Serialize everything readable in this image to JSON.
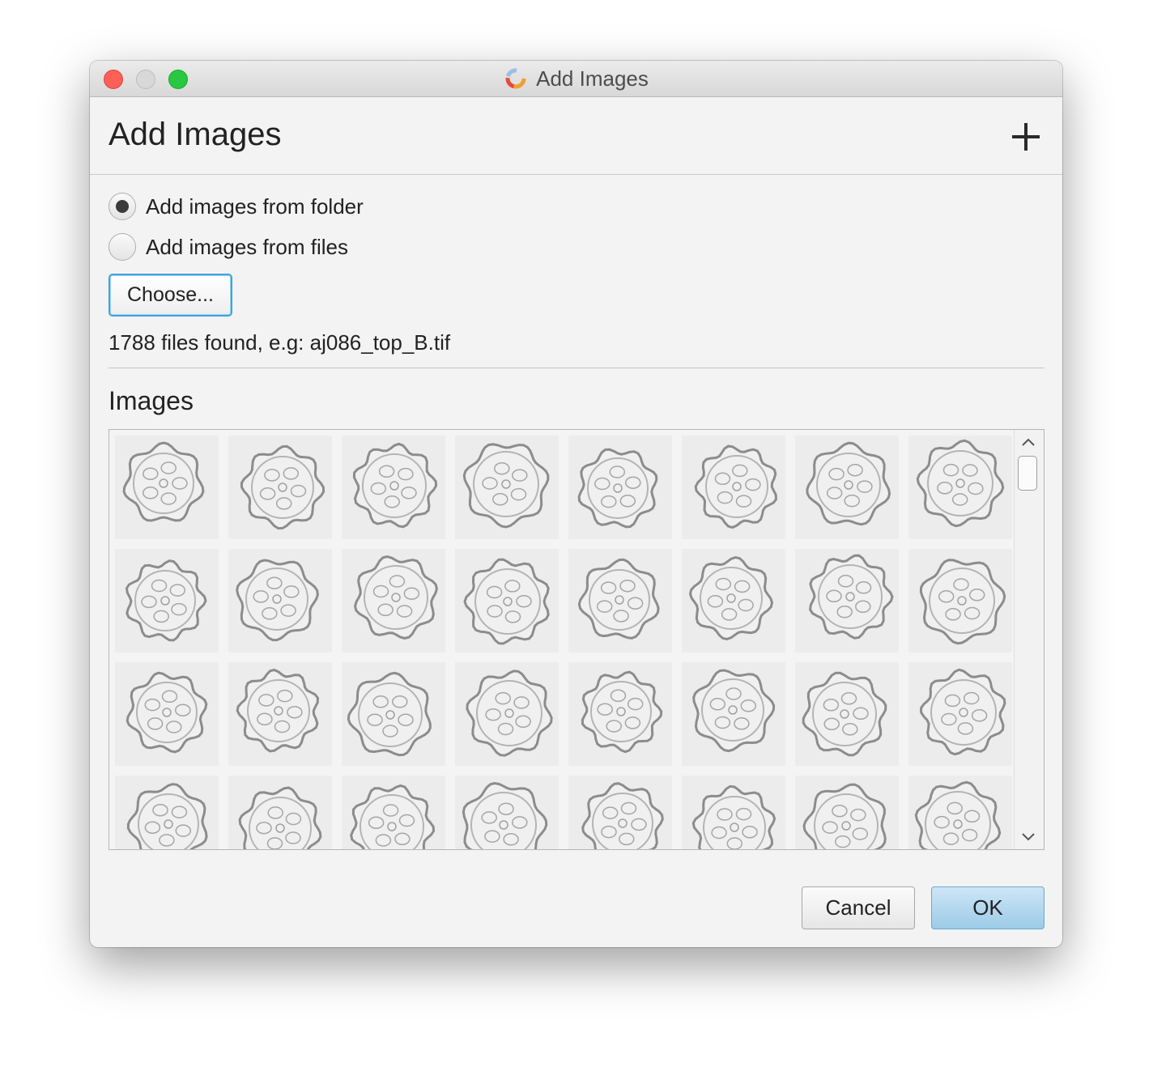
{
  "window": {
    "title": "Add Images",
    "app_icon": "spinner-logo-icon"
  },
  "header": {
    "title": "Add Images",
    "add_icon": "plus-icon"
  },
  "source": {
    "options": [
      {
        "label": "Add images from folder",
        "selected": true
      },
      {
        "label": "Add images from files",
        "selected": false
      }
    ],
    "choose_label": "Choose...",
    "files_found": "1788 files found, e.g: aj086_top_B.tif"
  },
  "images_section": {
    "title": "Images",
    "thumbnail_count": 32
  },
  "buttons": {
    "cancel": "Cancel",
    "ok": "OK"
  },
  "colors": {
    "accent": "#3da3df",
    "ok_button": "#a9d1ec",
    "close": "#fe5f57",
    "maximize": "#28c840"
  }
}
